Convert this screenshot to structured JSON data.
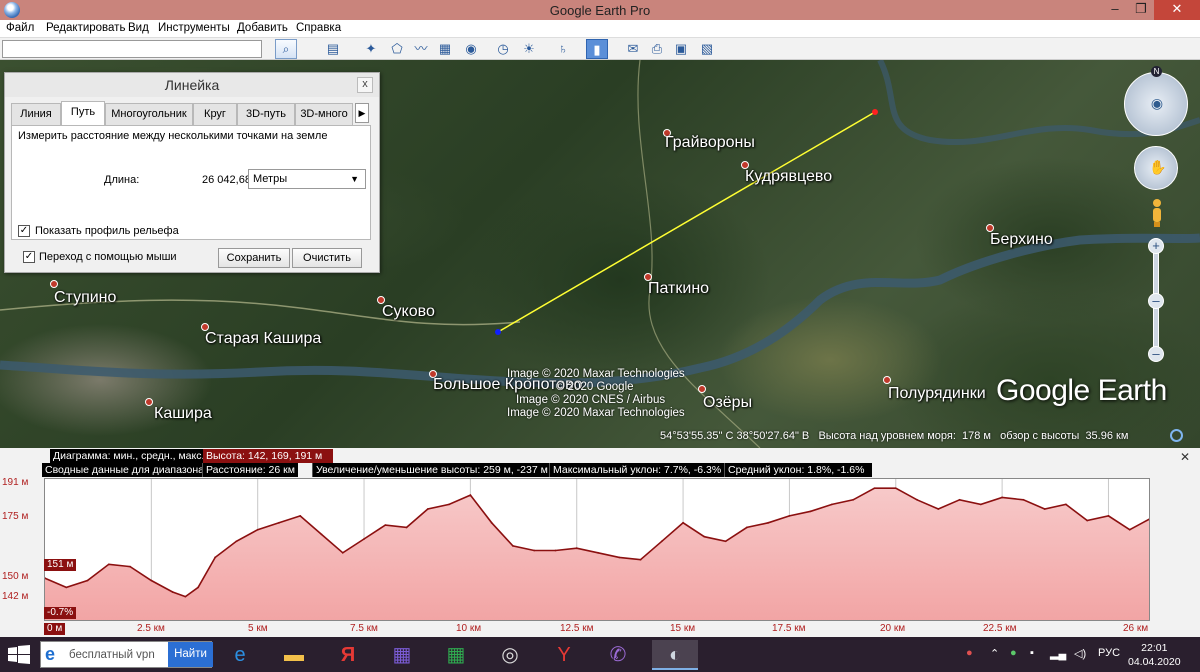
{
  "window": {
    "title": "Google Earth Pro",
    "minimize": "–",
    "restore": "❐",
    "close": "✕"
  },
  "menu": [
    "Файл",
    "Редактировать",
    "Вид",
    "Инструменты",
    "Добавить",
    "Справка"
  ],
  "toolbar": {
    "search_value": "",
    "icons": [
      "search-icon",
      "sidebar-icon",
      "placemark-icon",
      "polygon-icon",
      "path-icon",
      "overlay-icon",
      "tour-icon",
      "historical-imagery-icon",
      "sunlight-icon",
      "planets-icon",
      "ruler-icon",
      "email-icon",
      "print-icon",
      "save-image-icon",
      "maps-icon"
    ]
  },
  "map": {
    "labels": [
      "Грайвороны",
      "Кудрявцево",
      "Берхино",
      "Паткино",
      "Ступино",
      "Суково",
      "Старая Кашира",
      "Большое Кропотово",
      "Озёры",
      "Полурядинки",
      "Кашира"
    ],
    "credits": [
      "Image © 2020 Maxar Technologies",
      "© 2020 Google",
      "Image © 2020 CNES / Airbus",
      "Image © 2020 Maxar Technologies"
    ],
    "logo": "Google Earth",
    "status": {
      "coords": "54°53'55.35\" С   38°50'27.64\" В",
      "elevation_label": "Высота над уровнем моря:",
      "elevation": "178 м",
      "eye_label": "обзор с высоты",
      "eye_alt": "35.96 км"
    },
    "compass_n": "N"
  },
  "ruler": {
    "title": "Линейка",
    "close": "x",
    "tabs": [
      "Линия",
      "Путь",
      "Многоугольник",
      "Круг",
      "3D-путь",
      "3D-много"
    ],
    "active_tab": "Путь",
    "description": "Измерить расстояние между несколькими точками на земле",
    "length_label": "Длина:",
    "length_value": "26 042,68",
    "unit": "Метры",
    "show_profile": "Показать профиль рельефа",
    "mouse_nav": "Переход с помощью мыши",
    "save": "Сохранить",
    "clear": "Очистить"
  },
  "elevation_profile": {
    "stats_label": "Диаграмма: мин., средн., макс.:",
    "stats_value": "Высота: 142, 169, 191 м",
    "summary_label": "Сводные данные для диапазона:",
    "distance": "Расстояние: 26 км",
    "gain": "Увеличение/уменьшение высоты: 259 м, -237 м",
    "max_slope": "Максимальный уклон: 7.7%, -6.3%",
    "avg_slope": "Средний уклон: 1.8%, -1.6%",
    "current_height": "151 м",
    "current_slope": "-0.7%",
    "current_dist": "0 м",
    "close": "✕"
  },
  "chart_data": {
    "type": "area",
    "xlabel": "",
    "ylabel": "",
    "x_ticks": [
      "2.5 км",
      "5 км",
      "7.5 км",
      "10 км",
      "12.5 км",
      "15 км",
      "17.5 км",
      "20 км",
      "22.5 км",
      "26 км"
    ],
    "y_ticks": [
      "191 м",
      "175 м",
      "150 м",
      "142 м"
    ],
    "xlim": [
      0,
      26
    ],
    "ylim": [
      132,
      194
    ],
    "x": [
      0,
      0.5,
      1,
      1.5,
      2,
      2.5,
      3,
      3.3,
      3.6,
      4,
      4.5,
      5,
      5.5,
      6,
      6.5,
      7,
      7.5,
      8,
      8.5,
      9,
      9.5,
      10,
      10.5,
      11,
      11.5,
      12,
      12.5,
      13,
      13.5,
      14,
      14.5,
      15,
      15.5,
      16,
      16.5,
      17,
      17.5,
      18,
      18.5,
      19,
      19.5,
      20,
      20.5,
      21,
      21.5,
      22,
      22.5,
      23,
      23.5,
      24,
      24.5,
      25,
      25.5,
      26
    ],
    "y": [
      151,
      147,
      150,
      157,
      156,
      150,
      145,
      143,
      147,
      160,
      167,
      172,
      175,
      178,
      170,
      162,
      168,
      174,
      173,
      181,
      183,
      187,
      175,
      165,
      163,
      163,
      164,
      162,
      160,
      159,
      167,
      175,
      169,
      167,
      173,
      175,
      178,
      180,
      183,
      185,
      190,
      190,
      185,
      181,
      185,
      183,
      186,
      185,
      181,
      183,
      176,
      178,
      172,
      177
    ]
  },
  "taskbar": {
    "search_placeholder": "бесплатный vpn",
    "search_button": "Найти",
    "lang": "РУС",
    "time": "22:01",
    "date": "04.04.2020",
    "apps": [
      "edge-icon",
      "file-explorer-icon",
      "yandex-icon",
      "calculator-icon",
      "spreadsheet-icon",
      "cd-icon",
      "yandex-browser-icon",
      "viber-icon",
      "google-earth-icon"
    ]
  }
}
